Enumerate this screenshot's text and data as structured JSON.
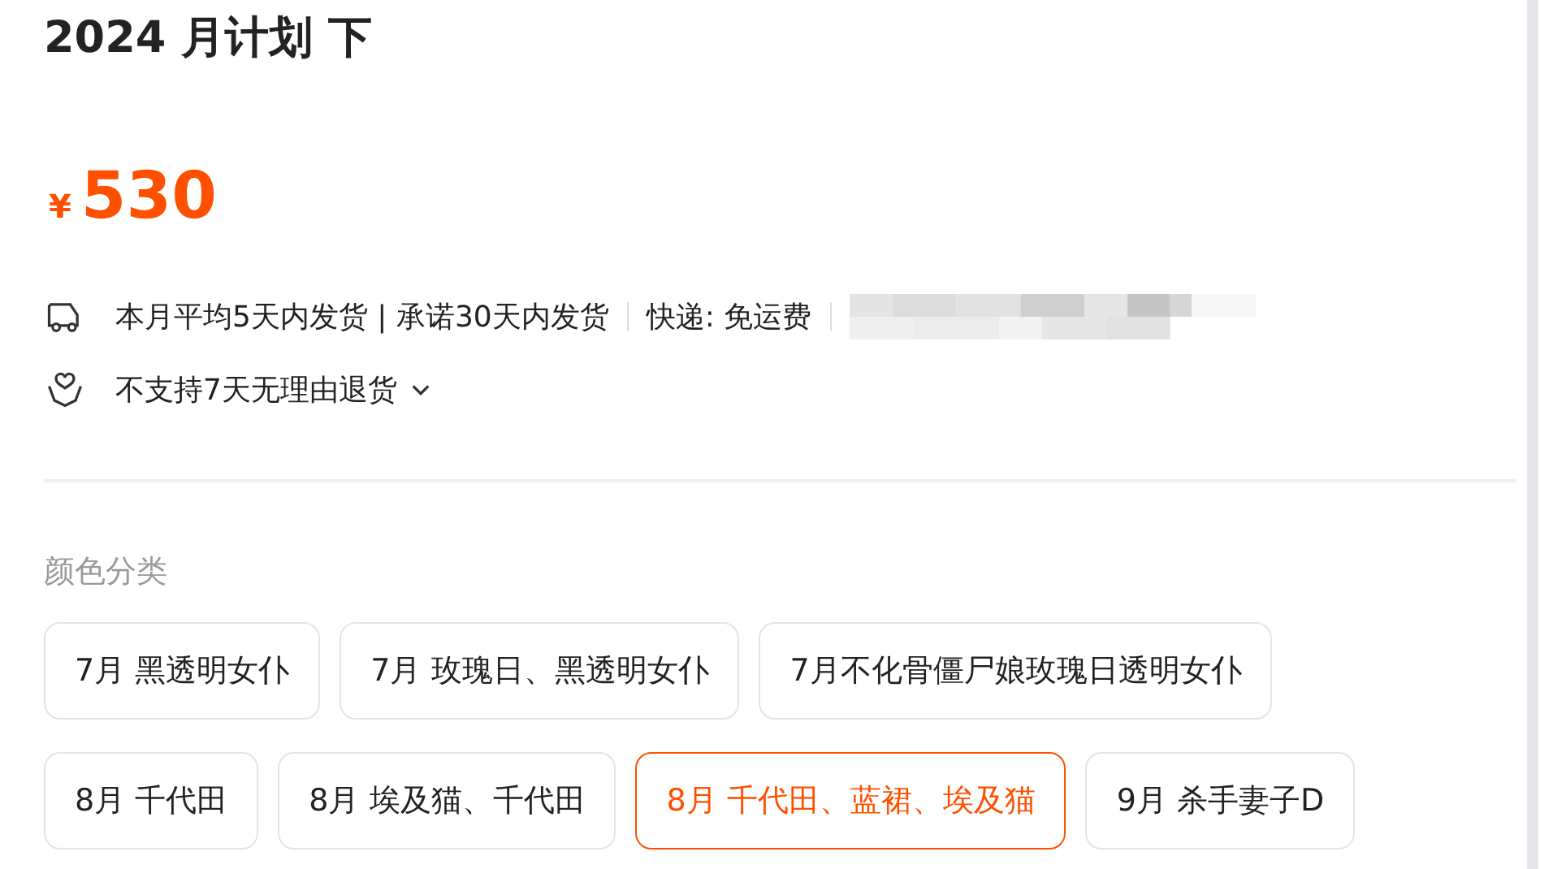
{
  "title": "2024 月计划 下",
  "price": {
    "currency": "¥",
    "amount": "530"
  },
  "delivery": {
    "items": [
      "本月平均5天内发货 | 承诺30天内发货",
      "快递: 免运费"
    ]
  },
  "returns": {
    "label": "不支持7天无理由退货"
  },
  "options": {
    "label": "颜色分类",
    "items": [
      {
        "label": "7月 黑透明女仆",
        "selected": false
      },
      {
        "label": "7月 玫瑰日、黑透明女仆",
        "selected": false
      },
      {
        "label": "7月不化骨僵尸娘玫瑰日透明女仆",
        "selected": false
      },
      {
        "label": "8月 千代田",
        "selected": false
      },
      {
        "label": "8月 埃及猫、千代田",
        "selected": false
      },
      {
        "label": "8月 千代田、蓝裙、埃及猫",
        "selected": true
      },
      {
        "label": "9月 杀手妻子D",
        "selected": false
      }
    ]
  }
}
